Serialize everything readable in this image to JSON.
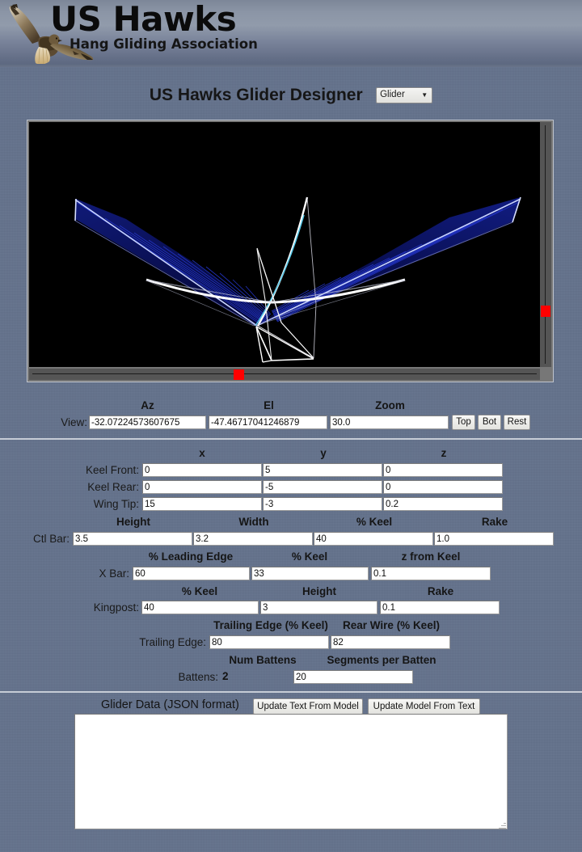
{
  "banner": {
    "title": "US Hawks",
    "subtitle": "Hang Gliding Association",
    "logo_icon": "hawk-logo-icon"
  },
  "page": {
    "title": "US Hawks Glider Designer",
    "model_select": {
      "selected": "Glider",
      "options": [
        "Glider"
      ],
      "caret_icon": "chevron-down-icon"
    }
  },
  "viewport": {
    "background_color": "#000000",
    "frame_color": "#777777",
    "scroll_thumb_color": "#ff0000",
    "vertical_scroll_name": "elevation-scrollbar",
    "horizontal_scroll_name": "azimuth-scrollbar"
  },
  "view": {
    "row_label": "View:",
    "headers": [
      "Az",
      "El",
      "Zoom"
    ],
    "az": "-32.07224573607675",
    "el": "-47.46717041246879",
    "zoom": "30.0",
    "buttons": [
      "Top",
      "Bot",
      "Rest"
    ]
  },
  "keel": {
    "headers": [
      "x",
      "y",
      "z"
    ],
    "rows": [
      {
        "label": "Keel Front:",
        "x": "0",
        "y": "5",
        "z": "0"
      },
      {
        "label": "Keel Rear:",
        "x": "0",
        "y": "-5",
        "z": "0"
      },
      {
        "label": "Wing Tip:",
        "x": "15",
        "y": "-3",
        "z": "0.2"
      }
    ]
  },
  "ctl_bar": {
    "label": "Ctl Bar:",
    "headers": [
      "Height",
      "Width",
      "% Keel",
      "Rake"
    ],
    "height": "3.5",
    "width": "3.2",
    "pct_keel": "40",
    "rake": "1.0"
  },
  "x_bar": {
    "label": "X Bar:",
    "headers": [
      "% Leading Edge",
      "% Keel",
      "z from Keel"
    ],
    "pct_leading_edge": "60",
    "pct_keel": "33",
    "z_from_keel": "0.1"
  },
  "kingpost": {
    "label": "Kingpost:",
    "headers": [
      "% Keel",
      "Height",
      "Rake"
    ],
    "pct_keel": "40",
    "height": "3",
    "rake": "0.1"
  },
  "trailing_edge": {
    "label": "Trailing Edge:",
    "headers": [
      "Trailing Edge (% Keel)",
      "Rear Wire (% Keel)"
    ],
    "trailing_edge": "80",
    "rear_wire": "82"
  },
  "battens": {
    "label": "Battens:",
    "headers": [
      "Num Battens",
      "Segments per Batten"
    ],
    "num_battens": "2",
    "segments_per_batten": "20"
  },
  "glider_data": {
    "label": "Glider Data (JSON format)",
    "update_text_from_model": "Update Text From Model",
    "update_model_from_text": "Update Model From Text",
    "text": "",
    "placeholder": ""
  },
  "colors": {
    "page_background": "#64728c",
    "banner_gradient_top": "#919bab",
    "banner_gradient_bottom": "#5a657e",
    "separator": "#c6ccd6",
    "sail_fill": "#0a0f4a",
    "sail_line": "#2030b0",
    "frame_line": "#ffffff",
    "accent_red": "#ff0000"
  }
}
